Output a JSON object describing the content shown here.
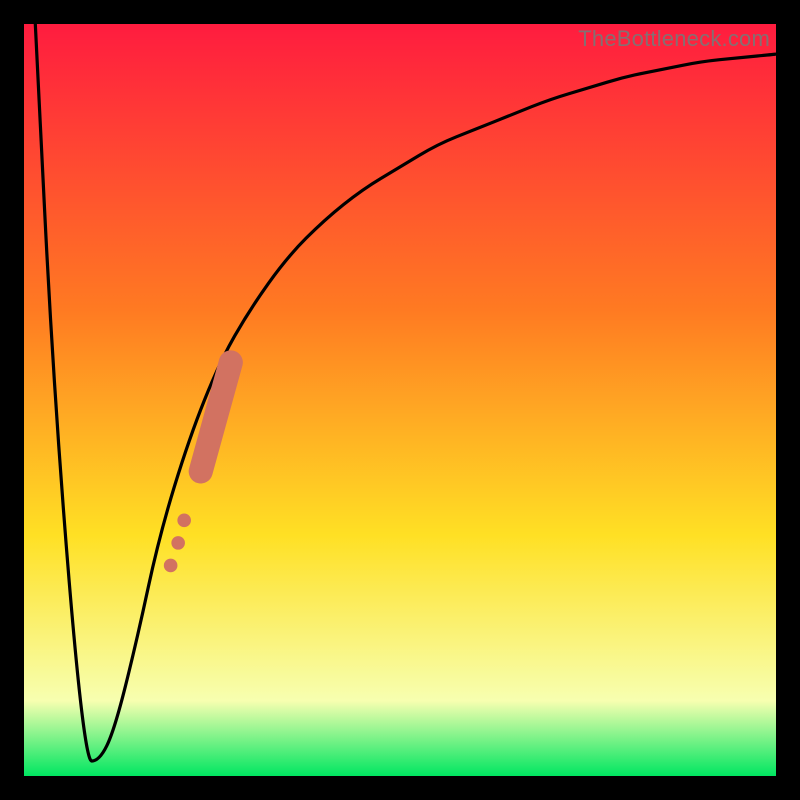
{
  "watermark": "TheBottleneck.com",
  "colors": {
    "frame": "#000000",
    "gradient_top": "#ff1c3f",
    "gradient_mid1": "#ff7a22",
    "gradient_mid2": "#ffe024",
    "gradient_mid3": "#f7ffb0",
    "gradient_bottom": "#00e661",
    "curve": "#000000",
    "markers": "#d27261"
  },
  "chart_data": {
    "type": "line",
    "title": "",
    "xlabel": "",
    "ylabel": "",
    "xlim": [
      0,
      100
    ],
    "ylim": [
      0,
      100
    ],
    "series": [
      {
        "name": "curve",
        "x": [
          1.5,
          4,
          8,
          10,
          12,
          15,
          18,
          22,
          26,
          30,
          35,
          40,
          45,
          50,
          55,
          60,
          65,
          70,
          75,
          80,
          85,
          90,
          95,
          100
        ],
        "y": [
          100,
          50,
          2,
          2,
          6,
          18,
          32,
          45,
          55,
          62,
          69,
          74,
          78,
          81,
          84,
          86,
          88,
          90,
          91.5,
          93,
          94,
          95,
          95.5,
          96
        ]
      }
    ],
    "markers": {
      "name": "highlighted-segment",
      "points": [
        {
          "x": 19.5,
          "y": 28,
          "r": 0.9
        },
        {
          "x": 20.5,
          "y": 31,
          "r": 0.9
        },
        {
          "x": 21.3,
          "y": 34,
          "r": 0.9
        },
        {
          "x": 23.5,
          "y": 40.5,
          "r": 1.6,
          "end_x": 27.5,
          "end_y": 55,
          "segment": true
        }
      ]
    }
  }
}
